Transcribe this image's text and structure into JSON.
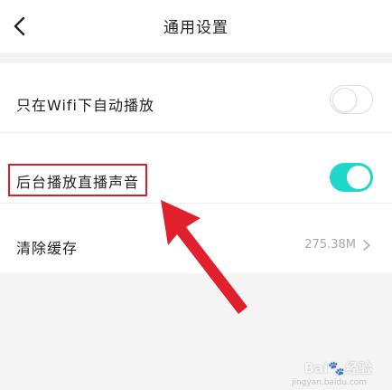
{
  "header": {
    "title": "通用设置",
    "back_icon": "chevron-left-icon"
  },
  "settings": {
    "wifi_autoplay": {
      "label": "只在Wifi下自动播放",
      "enabled": false
    },
    "background_live_audio": {
      "label": "后台播放直播声音",
      "enabled": true
    },
    "clear_cache": {
      "label": "清除缓存",
      "value": "275.38M",
      "icon": "chevron-right-icon"
    }
  },
  "annotation": {
    "box_color": "#d6202b",
    "arrow_color": "#e0202c"
  },
  "watermark": {
    "brand": "Bai",
    "brand_suffix": "经验",
    "url": "jingyan.baidu.com"
  },
  "colors": {
    "toggle_on": "#1ed6c9",
    "background": "#f4f4f4",
    "secondary_text": "#a8a8a8"
  }
}
